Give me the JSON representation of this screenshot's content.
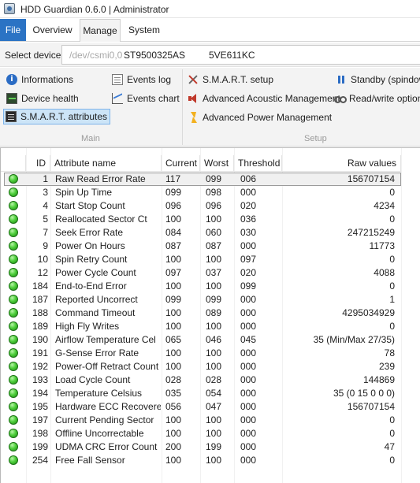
{
  "window": {
    "title": "HDD Guardian 0.6.0 | Administrator"
  },
  "menu": {
    "file": "File",
    "overview": "Overview",
    "manage": "Manage",
    "system": "System"
  },
  "device": {
    "label": "Select device",
    "path": "/dev/csmi0,0",
    "model": "ST9500325AS",
    "serial": "5VE611KC"
  },
  "ribbon": {
    "main": {
      "group_label": "Main",
      "informations": "Informations",
      "device_health": "Device health",
      "smart_attributes": "S.M.A.R.T. attributes",
      "events_log": "Events log",
      "events_chart": "Events chart"
    },
    "setup": {
      "group_label": "Setup",
      "smart_setup": "S.M.A.R.T. setup",
      "advanced_acoustic": "Advanced Acoustic Management",
      "advanced_power": "Advanced Power Management",
      "standby": "Standby (spindown",
      "read_write": "Read/write options"
    }
  },
  "table": {
    "headers": {
      "id": "ID",
      "name": "Attribute name",
      "current": "Current",
      "worst": "Worst",
      "threshold": "Threshold",
      "raw": "Raw values"
    },
    "selected_index": 0,
    "rows": [
      {
        "status": "ok",
        "id": "1",
        "name": "Raw Read Error Rate",
        "current": "117",
        "worst": "099",
        "threshold": "006",
        "raw": "156707154"
      },
      {
        "status": "ok",
        "id": "3",
        "name": "Spin Up Time",
        "current": "099",
        "worst": "098",
        "threshold": "000",
        "raw": "0"
      },
      {
        "status": "ok",
        "id": "4",
        "name": "Start Stop Count",
        "current": "096",
        "worst": "096",
        "threshold": "020",
        "raw": "4234"
      },
      {
        "status": "ok",
        "id": "5",
        "name": "Reallocated Sector Ct",
        "current": "100",
        "worst": "100",
        "threshold": "036",
        "raw": "0"
      },
      {
        "status": "ok",
        "id": "7",
        "name": "Seek Error Rate",
        "current": "084",
        "worst": "060",
        "threshold": "030",
        "raw": "247215249"
      },
      {
        "status": "ok",
        "id": "9",
        "name": "Power On Hours",
        "current": "087",
        "worst": "087",
        "threshold": "000",
        "raw": "11773"
      },
      {
        "status": "ok",
        "id": "10",
        "name": "Spin Retry Count",
        "current": "100",
        "worst": "100",
        "threshold": "097",
        "raw": "0"
      },
      {
        "status": "ok",
        "id": "12",
        "name": "Power Cycle Count",
        "current": "097",
        "worst": "037",
        "threshold": "020",
        "raw": "4088"
      },
      {
        "status": "ok",
        "id": "184",
        "name": "End-to-End Error",
        "current": "100",
        "worst": "100",
        "threshold": "099",
        "raw": "0"
      },
      {
        "status": "ok",
        "id": "187",
        "name": "Reported Uncorrect",
        "current": "099",
        "worst": "099",
        "threshold": "000",
        "raw": "1"
      },
      {
        "status": "ok",
        "id": "188",
        "name": "Command Timeout",
        "current": "100",
        "worst": "089",
        "threshold": "000",
        "raw": "4295034929"
      },
      {
        "status": "ok",
        "id": "189",
        "name": "High Fly Writes",
        "current": "100",
        "worst": "100",
        "threshold": "000",
        "raw": "0"
      },
      {
        "status": "ok",
        "id": "190",
        "name": "Airflow Temperature Cel",
        "current": "065",
        "worst": "046",
        "threshold": "045",
        "raw": "35 (Min/Max 27/35)"
      },
      {
        "status": "ok",
        "id": "191",
        "name": "G-Sense Error Rate",
        "current": "100",
        "worst": "100",
        "threshold": "000",
        "raw": "78"
      },
      {
        "status": "ok",
        "id": "192",
        "name": "Power-Off Retract Count",
        "current": "100",
        "worst": "100",
        "threshold": "000",
        "raw": "239"
      },
      {
        "status": "ok",
        "id": "193",
        "name": "Load Cycle Count",
        "current": "028",
        "worst": "028",
        "threshold": "000",
        "raw": "144869"
      },
      {
        "status": "ok",
        "id": "194",
        "name": "Temperature Celsius",
        "current": "035",
        "worst": "054",
        "threshold": "000",
        "raw": "35 (0 15 0 0 0)"
      },
      {
        "status": "ok",
        "id": "195",
        "name": "Hardware ECC Recovered",
        "current": "056",
        "worst": "047",
        "threshold": "000",
        "raw": "156707154"
      },
      {
        "status": "ok",
        "id": "197",
        "name": "Current Pending Sector",
        "current": "100",
        "worst": "100",
        "threshold": "000",
        "raw": "0"
      },
      {
        "status": "ok",
        "id": "198",
        "name": "Offline Uncorrectable",
        "current": "100",
        "worst": "100",
        "threshold": "000",
        "raw": "0"
      },
      {
        "status": "ok",
        "id": "199",
        "name": "UDMA CRC Error Count",
        "current": "200",
        "worst": "199",
        "threshold": "000",
        "raw": "47"
      },
      {
        "status": "ok",
        "id": "254",
        "name": "Free Fall Sensor",
        "current": "100",
        "worst": "100",
        "threshold": "000",
        "raw": "0"
      }
    ]
  },
  "colors": {
    "accent": "#2b73c4",
    "status_ok": "#3fbf2e",
    "selection": "#f0f0f0"
  }
}
